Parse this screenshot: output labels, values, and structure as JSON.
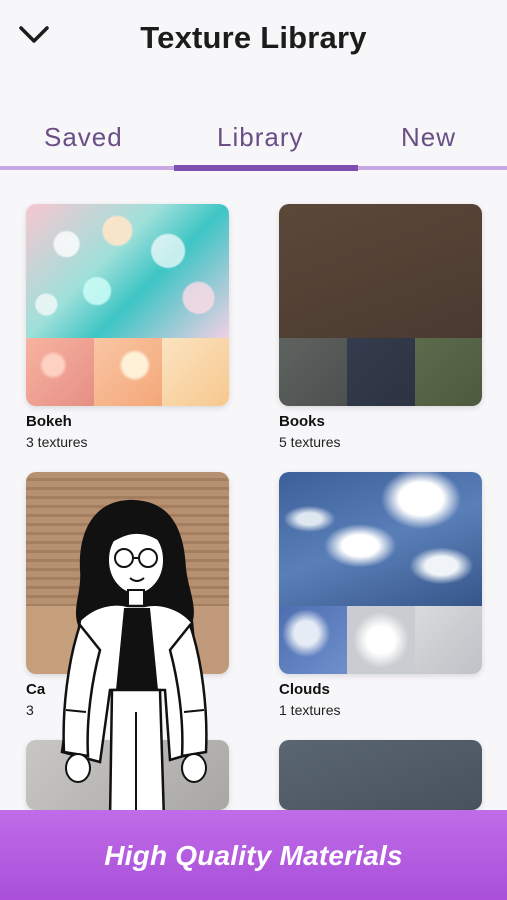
{
  "header": {
    "title": "Texture Library",
    "back_icon": "chevron-down-icon"
  },
  "tabs": [
    {
      "label": "Saved",
      "active": false
    },
    {
      "label": "Library",
      "active": true
    },
    {
      "label": "New",
      "active": false
    }
  ],
  "colors": {
    "accent": "#7d4fb0",
    "tab_text": "#6a4f86",
    "banner": "#b45de0"
  },
  "collections": [
    {
      "name": "Bokeh",
      "count": "3 textures"
    },
    {
      "name": "Books",
      "count": "5 textures"
    },
    {
      "name": "Ca",
      "count": "3"
    },
    {
      "name": "Clouds",
      "count": "1 textures"
    }
  ],
  "banner": {
    "text": "High Quality Materials"
  }
}
